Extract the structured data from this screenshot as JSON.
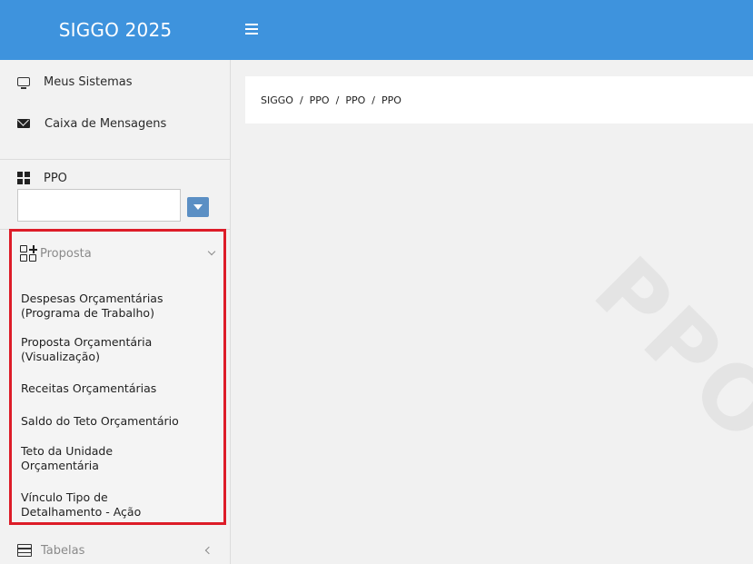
{
  "app": {
    "title": "SIGGO 2025"
  },
  "header": {
    "menu_icon": "hamburger-icon"
  },
  "sidebar": {
    "top_items": [
      {
        "label": "Meus Sistemas",
        "icon": "monitor-icon"
      },
      {
        "label": "Caixa de Mensagens",
        "icon": "envelope-icon"
      }
    ],
    "module": {
      "label": "PPO",
      "icon": "grid-icon",
      "select_value": ""
    },
    "group": {
      "label": "Proposta",
      "icon": "add-grid-icon",
      "expanded": true,
      "highlight_color": "#dd1c28",
      "items": [
        "Despesas Orçamentárias\n(Programa de Trabalho)",
        "Proposta Orçamentária\n(Visualização)",
        "Receitas Orçamentárias",
        "Saldo do Teto Orçamentário",
        "Teto da Unidade\nOrçamentária",
        "Vínculo Tipo de\nDetalhamento - Ação"
      ]
    },
    "tabelas": {
      "label": "Tabelas",
      "icon": "table-icon",
      "expanded": false
    }
  },
  "breadcrumb": {
    "items": [
      "SIGGO",
      "PPO",
      "PPO",
      "PPO"
    ],
    "separator": "/"
  },
  "watermark": {
    "text": "PPO"
  },
  "colors": {
    "header": "#3e93dd",
    "select_button": "#5b8fc4"
  }
}
